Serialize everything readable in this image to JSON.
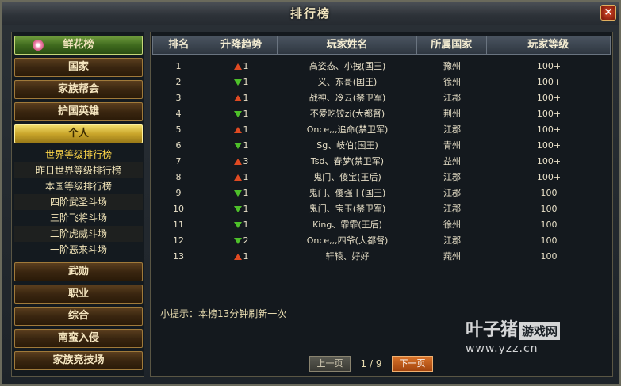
{
  "window": {
    "title": "排行榜",
    "close_label": "×"
  },
  "sidebar": {
    "top": {
      "label": "鲜花榜",
      "icon": "flower-icon"
    },
    "items_before": [
      "国家",
      "家族帮会",
      "护国英雄"
    ],
    "active": "个人",
    "sub_items": [
      "世界等级排行榜",
      "昨日世界等级排行榜",
      "本国等级排行榜",
      "四阶武圣斗场",
      "三阶飞将斗场",
      "二阶虎威斗场",
      "一阶恶来斗场"
    ],
    "selected_sub": 0,
    "items_after": [
      "武勋",
      "职业",
      "综合",
      "南蛮入侵",
      "家族竞技场"
    ]
  },
  "table": {
    "headers": [
      "排名",
      "升降趋势",
      "玩家姓名",
      "所属国家",
      "玩家等级"
    ],
    "rows": [
      {
        "rank": "1",
        "trend": "up",
        "change": "1",
        "name": "高姿态、小拽(国王)",
        "country": "豫州",
        "level": "100+"
      },
      {
        "rank": "2",
        "trend": "down",
        "change": "1",
        "name": "义、东哥(国王)",
        "country": "徐州",
        "level": "100+"
      },
      {
        "rank": "3",
        "trend": "up",
        "change": "1",
        "name": "战神、冷云(禁卫军)",
        "country": "江郡",
        "level": "100+"
      },
      {
        "rank": "4",
        "trend": "down",
        "change": "1",
        "name": "不爱吃饺zi(大都督)",
        "country": "荆州",
        "level": "100+"
      },
      {
        "rank": "5",
        "trend": "up",
        "change": "1",
        "name": "Once,,,追命(禁卫军)",
        "country": "江郡",
        "level": "100+"
      },
      {
        "rank": "6",
        "trend": "down",
        "change": "1",
        "name": "Sg、岐伯(国王)",
        "country": "青州",
        "level": "100+"
      },
      {
        "rank": "7",
        "trend": "up",
        "change": "3",
        "name": "Tsd、春梦(禁卫军)",
        "country": "益州",
        "level": "100+"
      },
      {
        "rank": "8",
        "trend": "up",
        "change": "1",
        "name": "鬼门、傻宝(王后)",
        "country": "江郡",
        "level": "100+"
      },
      {
        "rank": "9",
        "trend": "down",
        "change": "1",
        "name": "鬼门、傻强丨(国王)",
        "country": "江郡",
        "level": "100"
      },
      {
        "rank": "10",
        "trend": "down",
        "change": "1",
        "name": "鬼门、宝玉(禁卫军)",
        "country": "江郡",
        "level": "100"
      },
      {
        "rank": "11",
        "trend": "down",
        "change": "1",
        "name": "King、霏霏(王后)",
        "country": "徐州",
        "level": "100"
      },
      {
        "rank": "12",
        "trend": "down",
        "change": "2",
        "name": "Once,,,四爷(大都督)",
        "country": "江郡",
        "level": "100"
      },
      {
        "rank": "13",
        "trend": "up",
        "change": "1",
        "name": "轩辕、好好",
        "country": "燕州",
        "level": "100"
      }
    ]
  },
  "tip": "小提示：本榜13分钟刷新一次",
  "pager": {
    "prev_label": "上一页",
    "page_info": "1 / 9",
    "next_label": "下一页"
  },
  "watermark": {
    "brand": "叶子猪",
    "box": "游戏网",
    "url": "www.yzz.cn"
  },
  "colors": {
    "up": "#e04a22",
    "down": "#4ec02a",
    "accent": "#ffd84a"
  }
}
